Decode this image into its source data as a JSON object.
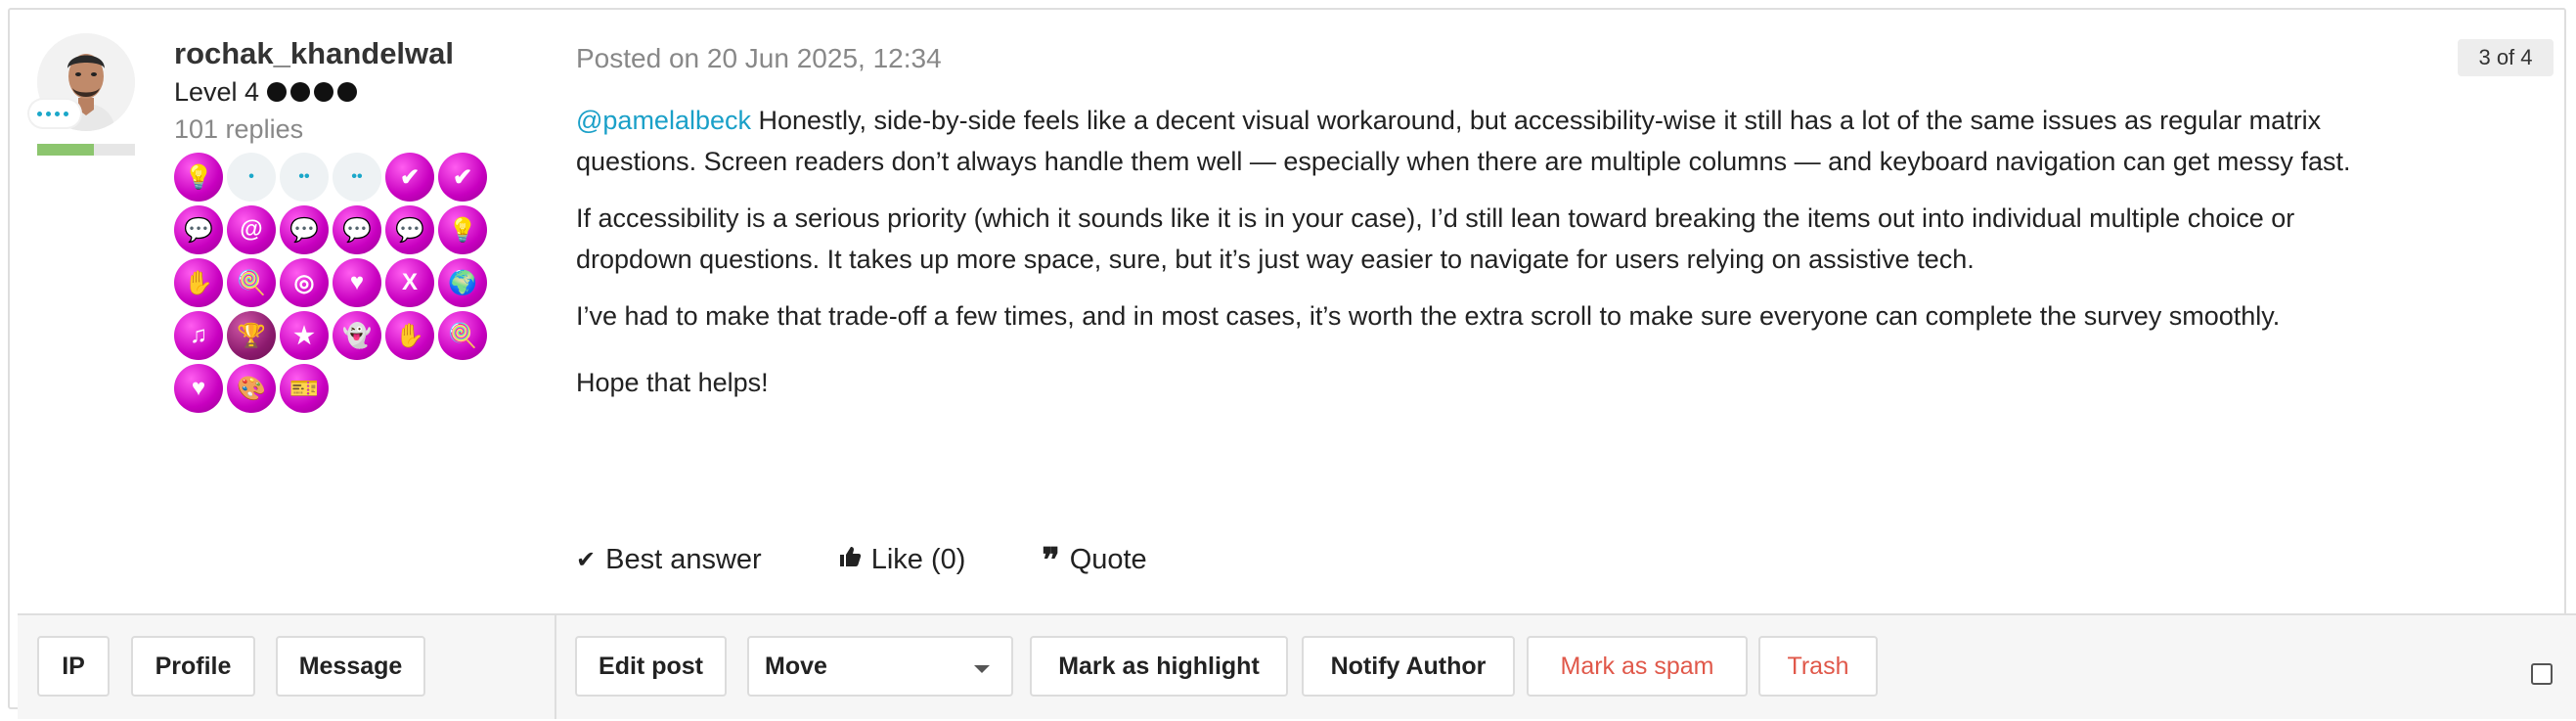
{
  "author": {
    "username": "rochak_khandelwal",
    "level": "Level 4",
    "replies": "101 replies",
    "rank_progress": 0.58,
    "badges": [
      "lightbulb",
      "dot",
      "dots",
      "dots",
      "check",
      "check",
      "chat",
      "at",
      "chat",
      "chat",
      "chat",
      "lightbulb",
      "hands",
      "candy",
      "target",
      "heart",
      "x",
      "globe",
      "music",
      "trophy",
      "star",
      "ghost",
      "hands",
      "candy",
      "heart",
      "palette",
      "ticket"
    ]
  },
  "post": {
    "date": "Posted on 20 Jun 2025, 12:34",
    "counter": "3 of 4",
    "mention": "@pamelalbeck",
    "paragraph1": " Honestly, side-by-side feels like a decent visual workaround, but accessibility-wise it still has a lot of the same issues as regular matrix questions. Screen readers don’t always handle them well — especially when there are multiple columns — and keyboard navigation can get messy fast.",
    "paragraph2": "If accessibility is a serious priority (which it sounds like it is in your case), I’d still lean toward breaking the items out into individual multiple choice or dropdown questions. It takes up more space, sure, but it’s just way easier to navigate for users relying on assistive tech.",
    "paragraph3": "I’ve had to make that trade-off a few times, and in most cases, it’s worth the extra scroll to make sure everyone can complete the survey smoothly.",
    "paragraph4": "Hope that helps!"
  },
  "actions": {
    "best_answer": "Best answer",
    "like": "Like (0)",
    "quote": "Quote"
  },
  "toolbar": {
    "ip": "IP",
    "profile": "Profile",
    "message": "Message",
    "edit_post": "Edit post",
    "move": "Move",
    "mark_highlight": "Mark as highlight",
    "notify_author": "Notify Author",
    "mark_spam": "Mark as spam",
    "trash": "Trash"
  },
  "colors": {
    "mention": "#1aa0c8",
    "danger": "#e0584a",
    "badge": "#d400c8",
    "progress": "#8cc56e"
  }
}
